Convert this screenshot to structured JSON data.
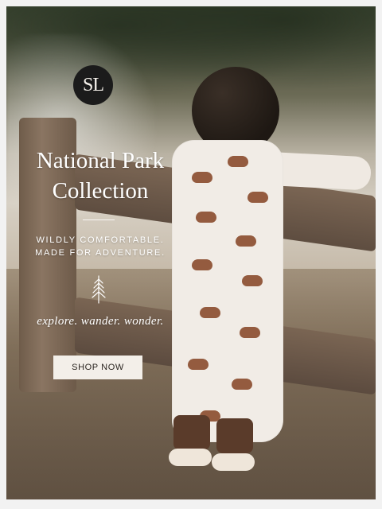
{
  "hero": {
    "logo_text": "SL",
    "title_line1": "National Park",
    "title_line2": "Collection",
    "tagline_line1": "WILDLY COMFORTABLE.",
    "tagline_line2": "MADE FOR ADVENTURE.",
    "script_text": "explore. wander. wonder.",
    "cta_label": "SHOP NOW"
  },
  "icons": {
    "logo": "brand-monogram-icon",
    "decoration": "pine-tree-icon"
  },
  "colors": {
    "cta_background": "#f3efe9",
    "cta_text": "#2a2520",
    "overlay_text": "#ffffff",
    "logo_background": "#1b1b1b"
  }
}
